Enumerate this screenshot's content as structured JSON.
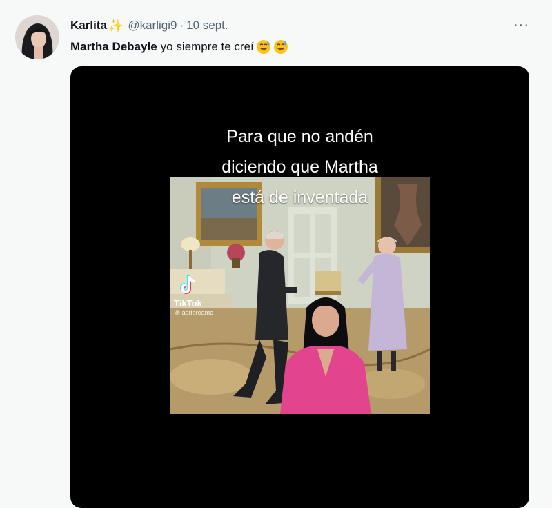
{
  "tweet": {
    "author_name": "Karlita",
    "sparkle_icon": "sparkles-icon",
    "handle": "@karligi9",
    "separator": "·",
    "date": "10 sept.",
    "more_label": "···",
    "mention": "Martha Debayle",
    "text": "yo siempre te creí",
    "emojis": [
      "grinning-sweat-emoji",
      "grinning-sweat-emoji"
    ]
  },
  "media": {
    "caption_lines": [
      "Para que no andén",
      "diciendo que Martha",
      "está de inventada"
    ],
    "watermark_label": "TikTok",
    "watermark_user": "@ adribreamc"
  },
  "colors": {
    "background": "#f7f9f9",
    "text": "#0f1419",
    "secondary": "#536471",
    "media_bg": "#000000",
    "sparkle": "#f4b400"
  }
}
